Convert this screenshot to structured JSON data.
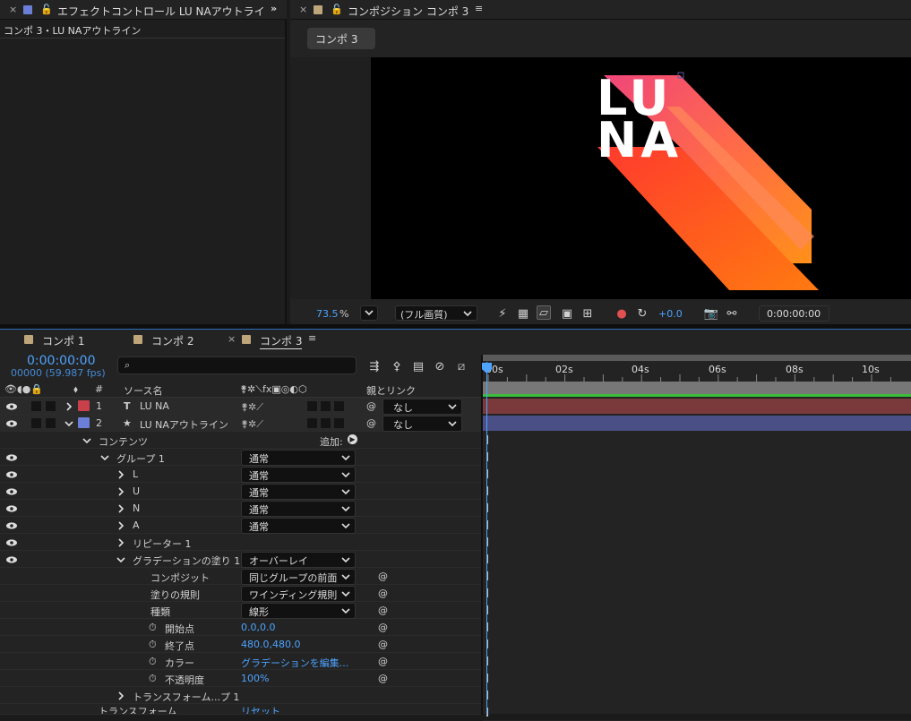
{
  "effect_panel": {
    "title": "エフェクトコントロール LU NAアウトライン",
    "subtitle": "コンポ 3・LU NAアウトライン"
  },
  "comp_panel": {
    "title": "コンポジション コンポ 3",
    "comp_button": "コンポ 3",
    "artwork_text_line1": "LU",
    "artwork_text_line2": "NA",
    "zoom_value": "73.5",
    "zoom_unit": "%",
    "quality": "(フル画質)",
    "exposure": "+0.0",
    "timecode": "0:00:00:00"
  },
  "timeline": {
    "tabs": [
      "コンポ 1",
      "コンポ 2",
      "コンポ 3"
    ],
    "current_time": "0:00:00:00",
    "frame_info": "00000 (59.987 fps)",
    "search_placeholder": "",
    "col_source": "ソース名",
    "col_num": "#",
    "col_parent": "親とリンク",
    "ruler": [
      "00s",
      "02s",
      "04s",
      "06s",
      "08s",
      "10s"
    ],
    "layers": [
      {
        "num": "1",
        "type_icon": "T",
        "name": "LU NA",
        "color": "#c9404a",
        "parent": "なし"
      },
      {
        "num": "2",
        "type_icon": "★",
        "name": "LU NAアウトライン",
        "color": "#6b7fd8",
        "parent": "なし"
      }
    ],
    "contents_label": "コンテンツ",
    "add_label": "追加:",
    "group_label": "グループ 1",
    "group_mode": "通常",
    "children": [
      {
        "name": "L",
        "mode": "通常"
      },
      {
        "name": "U",
        "mode": "通常"
      },
      {
        "name": "N",
        "mode": "通常"
      },
      {
        "name": "A",
        "mode": "通常"
      }
    ],
    "repeater": "リピーター 1",
    "gradfill": {
      "label": "グラデーションの塗り 1",
      "mode": "オーバーレイ",
      "props": [
        {
          "name": "コンポジット",
          "value": "同じグループの前面"
        },
        {
          "name": "塗りの規則",
          "value": "ワインディング規則"
        },
        {
          "name": "種類",
          "value": "線形"
        }
      ],
      "start_label": "開始点",
      "start_value": "0.0,0.0",
      "end_label": "終了点",
      "end_value": "480.0,480.0",
      "color_label": "カラー",
      "color_value": "グラデーションを編集...",
      "opacity_label": "不透明度",
      "opacity_value": "100%"
    },
    "transform_group": "トランスフォーム...プ 1",
    "transform_partial": "トランスフォーム",
    "transform_value_partial": "リセット"
  },
  "colors": {
    "accent_blue": "#4da3ff",
    "layer1_bar": "#7a3a3c",
    "layer2_bar": "#4a4f86",
    "green_line": "#3bbd3b"
  }
}
